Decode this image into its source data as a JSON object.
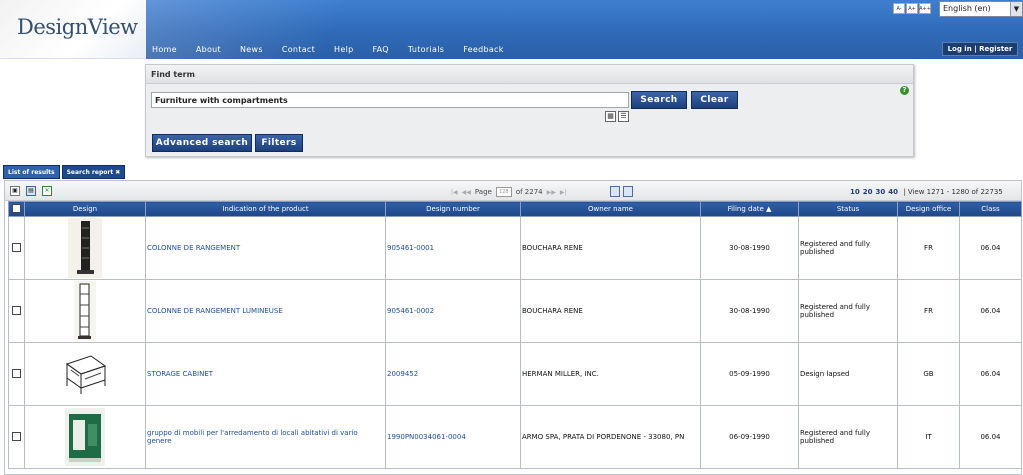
{
  "app": {
    "logo_text": "DesignView"
  },
  "nav": {
    "items": [
      "Home",
      "About",
      "News",
      "Contact",
      "Help",
      "FAQ",
      "Tutorials",
      "Feedback"
    ]
  },
  "font_size_buttons": [
    "A-",
    "A+",
    "A++"
  ],
  "language": {
    "selected": "English (en)"
  },
  "login": {
    "label": "Log in | Register"
  },
  "find": {
    "title": "Find term",
    "query": "Furniture with compartments",
    "search_label": "Search",
    "clear_label": "Clear",
    "advanced_label": "Advanced search",
    "filters_label": "Filters"
  },
  "tabs": [
    {
      "label": "List of results"
    },
    {
      "label": "Search report ✖"
    }
  ],
  "pager": {
    "page_label": "Page",
    "page_value": "128",
    "of_text": "of 2274",
    "per_page_options": [
      "10",
      "20",
      "30",
      "40"
    ],
    "view_text": "| View 1271 - 1280 of 22735"
  },
  "table": {
    "headers": [
      "",
      "Design",
      "Indication of the product",
      "Design number",
      "Owner name",
      "Filing date ▲",
      "Status",
      "Design office",
      "Class"
    ],
    "rows": [
      {
        "indication": "COLONNE DE RANGEMENT",
        "number": "905461-0001",
        "owner": "BOUCHARA RENE",
        "date": "30-08-1990",
        "status": "Registered and fully published",
        "office": "FR",
        "class": "06.04"
      },
      {
        "indication": "COLONNE DE RANGEMENT LUMINEUSE",
        "number": "905461-0002",
        "owner": "BOUCHARA RENE",
        "date": "30-08-1990",
        "status": "Registered and fully published",
        "office": "FR",
        "class": "06.04"
      },
      {
        "indication": "STORAGE CABINET",
        "number": "2009452",
        "owner": "HERMAN MILLER, INC.",
        "date": "05-09-1990",
        "status": "Design lapsed",
        "office": "GB",
        "class": "06.04"
      },
      {
        "indication": "gruppo di mobili per l'arredamento di locali abitativi di vario genere",
        "number": "1990PN0034061-0004",
        "owner": "ARMO SPA, PRATA DI PORDENONE - 33080, PN",
        "date": "06-09-1990",
        "status": "Registered and fully published",
        "office": "IT",
        "class": "06.04"
      }
    ]
  }
}
